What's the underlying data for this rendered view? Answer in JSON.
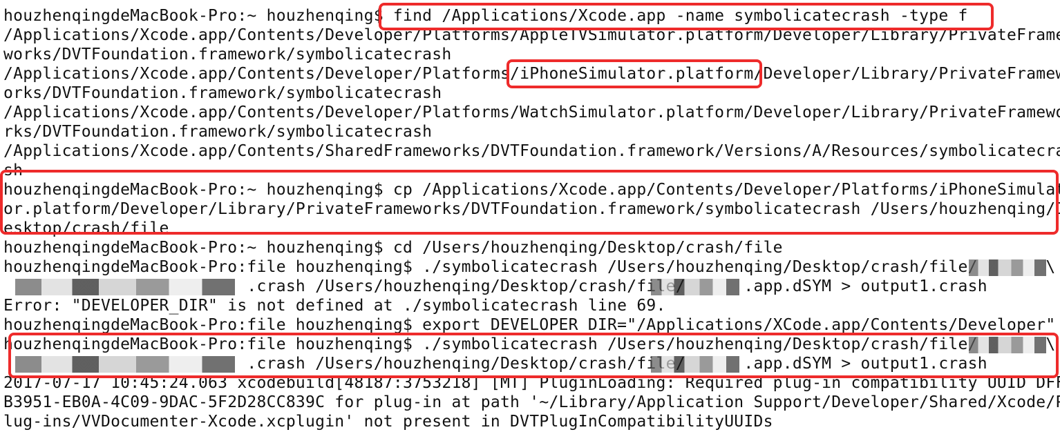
{
  "terminal": {
    "lines": [
      "houzhenqingdeMacBook-Pro:~ houzhenqing$ find /Applications/Xcode.app -name symbolicatecrash -type f",
      "/Applications/Xcode.app/Contents/Developer/Platforms/AppleTVSimulator.platform/Developer/Library/PrivateFrame",
      "works/DVTFoundation.framework/symbolicatecrash",
      "/Applications/Xcode.app/Contents/Developer/Platforms/iPhoneSimulator.platform/Developer/Library/PrivateFramew",
      "orks/DVTFoundation.framework/symbolicatecrash",
      "/Applications/Xcode.app/Contents/Developer/Platforms/WatchSimulator.platform/Developer/Library/PrivateFramewo",
      "rks/DVTFoundation.framework/symbolicatecrash",
      "/Applications/Xcode.app/Contents/SharedFrameworks/DVTFoundation.framework/Versions/A/Resources/symbolicatecra",
      "sh",
      "houzhenqingdeMacBook-Pro:~ houzhenqing$ cp /Applications/Xcode.app/Contents/Developer/Platforms/iPhoneSimulat",
      "or.platform/Developer/Library/PrivateFrameworks/DVTFoundation.framework/symbolicatecrash /Users/houzhenqing/D",
      "esktop/crash/file",
      "houzhenqingdeMacBook-Pro:~ houzhenqing$ cd /Users/houzhenqing/Desktop/crash/file",
      "houzhenqingdeMacBook-Pro:file houzhenqing$ ./symbolicatecrash /Users/houzhenqing/Desktop/crash/file/       \\",
      "                         .crash /Users/houzhenqing/Desktop/crash/file/      .app.dSYM > output1.crash",
      "Error: \"DEVELOPER_DIR\" is not defined at ./symbolicatecrash line 69.",
      "houzhenqingdeMacBook-Pro:file houzhenqing$ export DEVELOPER_DIR=\"/Applications/XCode.app/Contents/Developer\"",
      "houzhenqingdeMacBook-Pro:file houzhenqing$ ./symbolicatecrash /Users/houzhenqing/Desktop/crash/file/       \\",
      "                         .crash /Users/houzhenqing/Desktop/crash/file/      .app.dSYM > output1.crash",
      "2017-07-17 10:45:24.063 xcodebuild[48187:3753218] [MT] PluginLoading: Required plug-in compatibility UUID DFF",
      "B3951-EB0A-4C09-9DAC-5F2D28CC839C for plug-in at path '~/Library/Application Support/Developer/Shared/Xcode/P",
      "lug-ins/VVDocumenter-Xcode.xcplugin' not present in DVTPlugInCompatibilityUUIDs"
    ]
  },
  "highlight_color": "#ee2b2b"
}
